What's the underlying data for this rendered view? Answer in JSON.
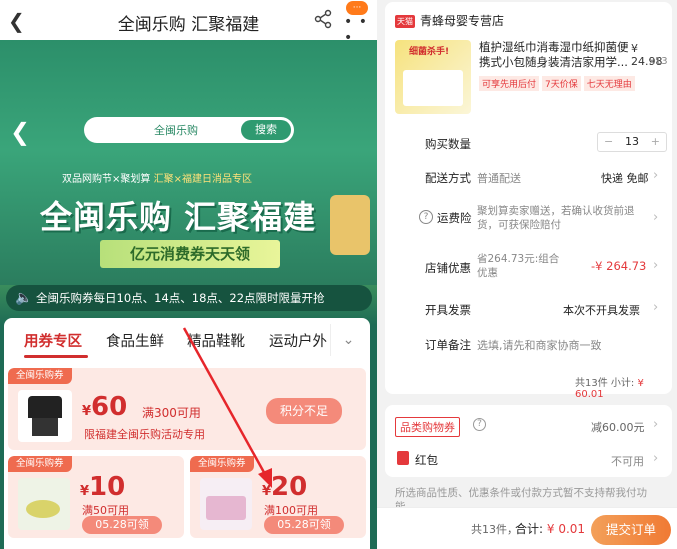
{
  "left": {
    "topbar": {
      "title": "全闽乐购 汇聚福建",
      "more_badge": "···"
    },
    "banner": {
      "search_placeholder": "全闽乐购",
      "search_button": "搜索",
      "subtitle_a": "双品网购节×聚划算",
      "subtitle_b": "汇聚×福建日消品专区",
      "headline": "全闽乐购 汇聚福建",
      "ribbon": "亿元消费券天天领"
    },
    "notice": "全闽乐购券每日10点、14点、18点、22点限时限量开抢",
    "tabs": [
      "用券专区",
      "食品生鲜",
      "精品鞋靴",
      "运动户外"
    ],
    "coupons": [
      {
        "tag": "全闽乐购券",
        "currency": "¥",
        "amount": "60",
        "condition": "满300可用",
        "desc": "限福建全闽乐购活动专用",
        "button": "积分不足"
      },
      {
        "tag": "全闽乐购券",
        "currency": "¥",
        "amount": "10",
        "condition": "满50可用",
        "button": "05.28可领"
      },
      {
        "tag": "全闽乐购券",
        "currency": "¥",
        "amount": "20",
        "condition": "满100可用",
        "button": "05.28可领"
      }
    ]
  },
  "right": {
    "shop": {
      "badge": "天猫",
      "name": "青蜂母婴专营店"
    },
    "product": {
      "image_label": "细菌杀手!",
      "name": "植护湿纸巾消毒湿巾纸抑菌便携式小包随身装清洁家用学...",
      "price": "¥ 24.98",
      "qty": "x13",
      "tags": [
        "可享先用后付",
        "7天价保",
        "七天无理由"
      ]
    },
    "rows": {
      "quantity_label": "购买数量",
      "quantity_value": "13",
      "delivery_label": "配送方式",
      "delivery_mode": "普通配送",
      "delivery_value": "快递 免邮",
      "insurance_label": "运费险",
      "insurance_value": "聚划算卖家赠送，若确认收货前退货，可获保险赔付",
      "discount_label": "店铺优惠",
      "discount_desc": "省264.73元:组合优惠",
      "discount_value": "-¥ 264.73",
      "invoice_label": "开具发票",
      "invoice_value": "本次不开具发票",
      "remark_label": "订单备注",
      "remark_placeholder": "选填,请先和商家协商一致"
    },
    "summary": {
      "count": "共13件",
      "subtotal_label": "小计:",
      "subtotal": "¥ 60.01"
    },
    "voucher": {
      "label": "品类购物券",
      "value": "减60.00元"
    },
    "redpacket": {
      "label": "红包",
      "value": "不可用"
    },
    "note": "所选商品性质、优惠条件或付款方式暂不支持帮我付功能",
    "bottom": {
      "count": "共13件，",
      "total_label": "合计:",
      "total": "¥ 0.01",
      "submit": "提交订单"
    }
  },
  "colors": {
    "accent": "#e4393c",
    "green": "#1e6b55",
    "orange": "#f07a34"
  }
}
